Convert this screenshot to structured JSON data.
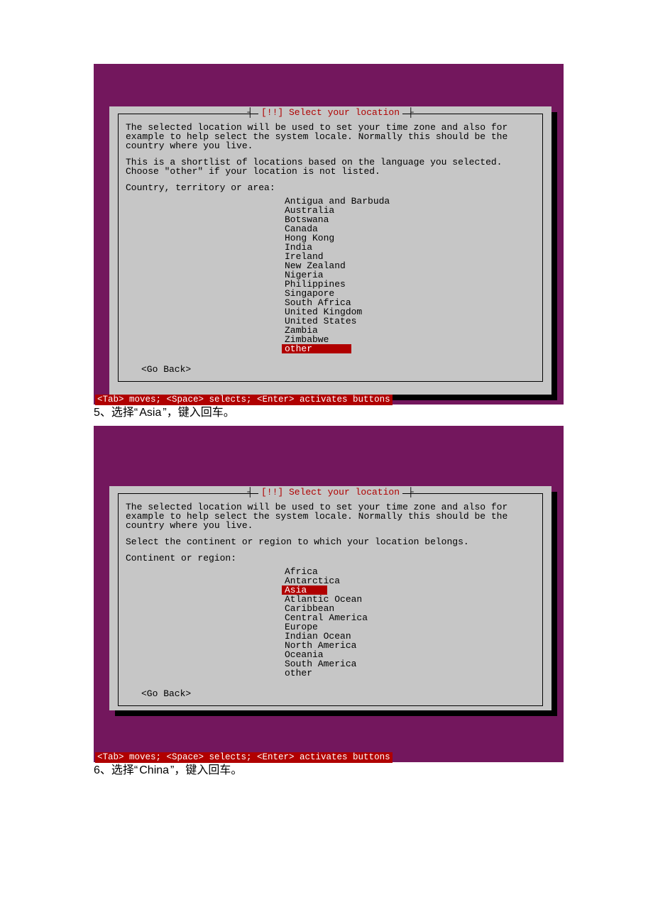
{
  "screens": [
    {
      "title": "[!!] Select your location",
      "para1": "The selected location will be used to set your time zone and also for example to help select the system locale. Normally this should be the country where you live.",
      "para2": "This is a shortlist of locations based on the language you selected. Choose \"other\" if your location is not listed.",
      "prompt": "Country, territory or area:",
      "options": [
        "Antigua and Barbuda",
        "Australia",
        "Botswana",
        "Canada",
        "Hong Kong",
        "India",
        "Ireland",
        "New Zealand",
        "Nigeria",
        "Philippines",
        "Singapore",
        "South Africa",
        "United Kingdom",
        "United States",
        "Zambia",
        "Zimbabwe",
        "other"
      ],
      "selected": "other",
      "goback": "<Go Back>",
      "status": "<Tab> moves; <Space> selects; <Enter> activates buttons"
    },
    {
      "title": "[!!] Select your location",
      "para1": "The selected location will be used to set your time zone and also for example to help select the system locale. Normally this should be the country where you live.",
      "para2": "Select the continent or region to which your location belongs.",
      "prompt": "Continent or region:",
      "options": [
        "Africa",
        "Antarctica",
        "Asia",
        "Atlantic Ocean",
        "Caribbean",
        "Central America",
        "Europe",
        "Indian Ocean",
        "North America",
        "Oceania",
        "South America",
        "other"
      ],
      "selected": "Asia",
      "goback": "<Go Back>",
      "status": "<Tab> moves; <Space> selects; <Enter> activates buttons"
    }
  ],
  "captions": {
    "c1_prefix": "5、选择“",
    "c1_latin": "Asia",
    "c1_suffix": "”，键入回车。",
    "c2_prefix": "6、选择“",
    "c2_latin": "China",
    "c2_suffix": "”，键入回车。"
  }
}
